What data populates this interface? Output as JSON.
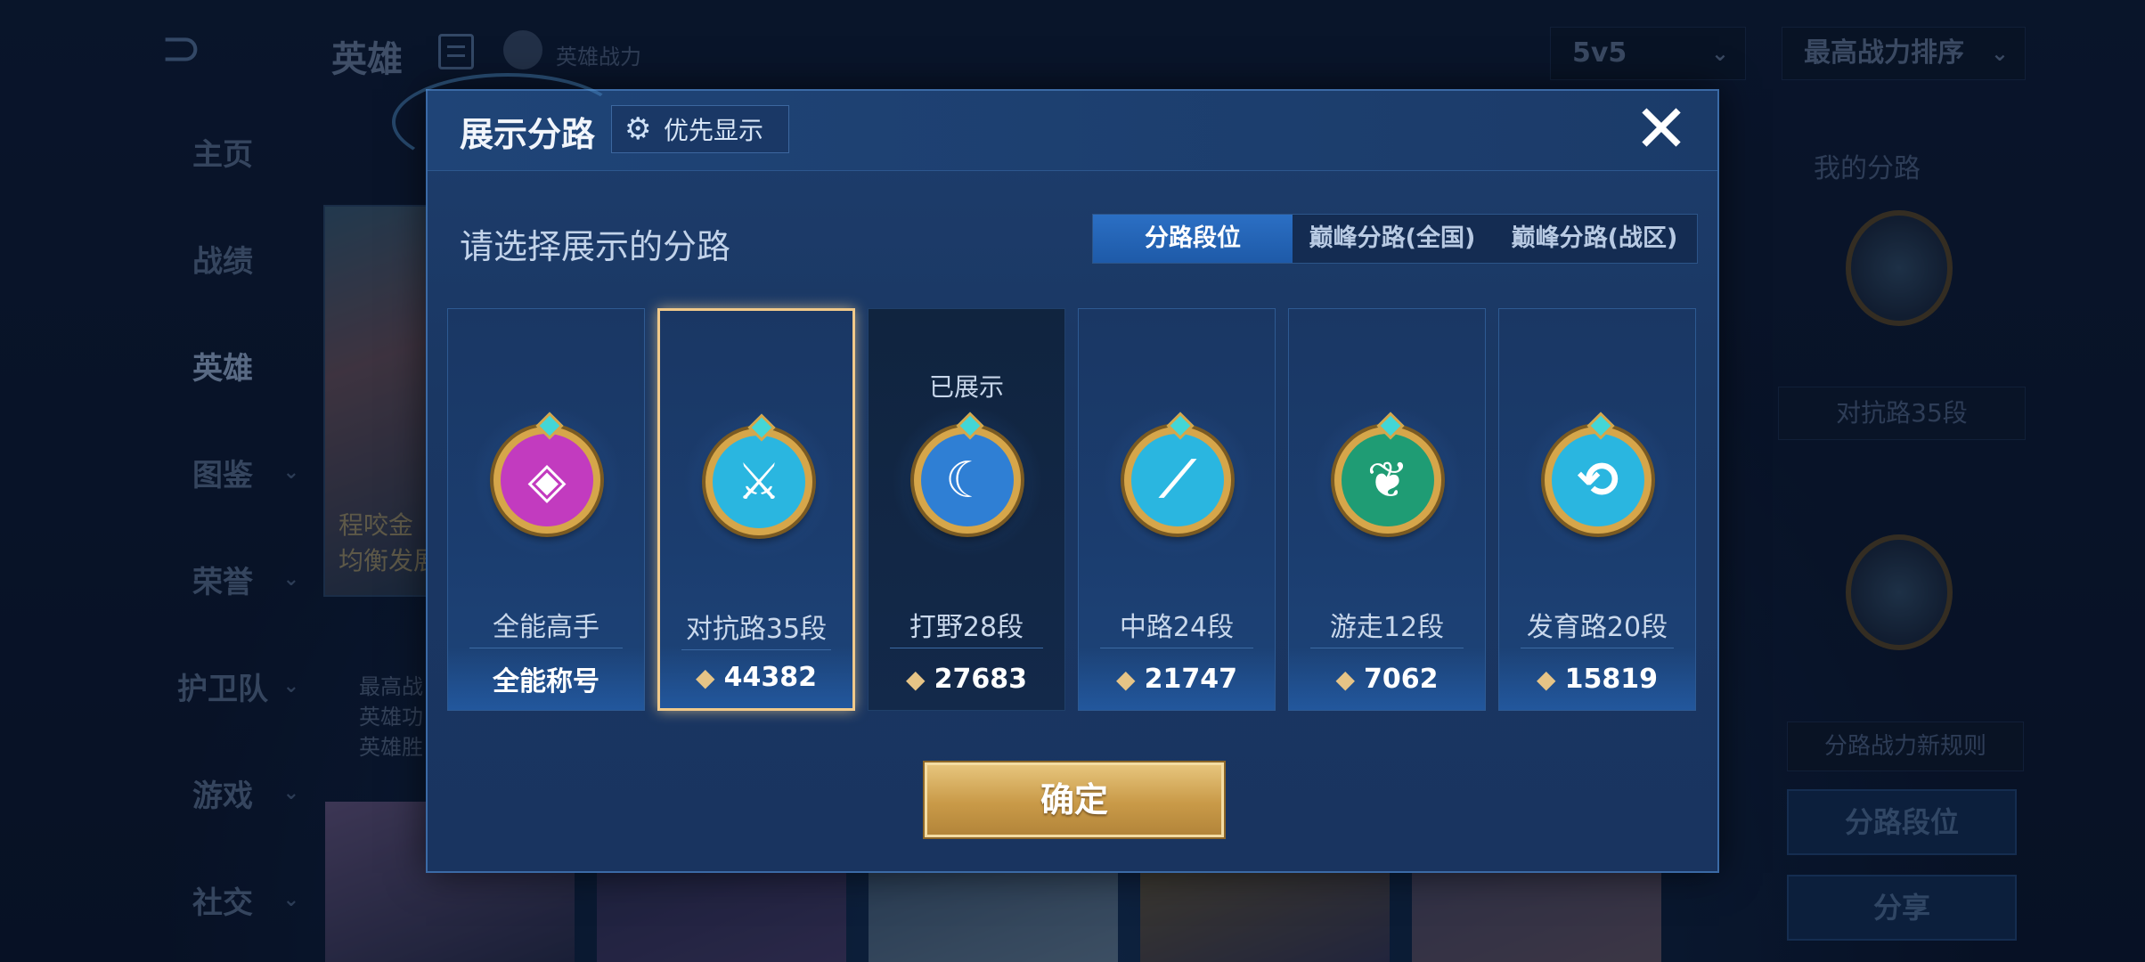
{
  "background": {
    "page_title": "英雄",
    "hero_power_label": "英雄战力",
    "mode_select": "5v5",
    "sort_select": "最高战力排序",
    "nav": [
      {
        "label": "主页"
      },
      {
        "label": "战绩"
      },
      {
        "label": "英雄"
      },
      {
        "label": "图鉴"
      },
      {
        "label": "荣誉"
      },
      {
        "label": "护卫队"
      },
      {
        "label": "游戏"
      },
      {
        "label": "社交"
      }
    ],
    "hero_card_text": [
      "程咬金",
      "均衡发展"
    ],
    "hero_info": [
      "最高战",
      "英雄功",
      "英雄胜"
    ],
    "right_panel": {
      "title": "我的分路",
      "rank": "对抗路35段",
      "rule_button": "分路战力新规则",
      "lane_rank_button": "分路段位",
      "share_button": "分享"
    }
  },
  "modal": {
    "title": "展示分路",
    "priority_label": "优先显示",
    "close_label": "✕",
    "prompt": "请选择展示的分路",
    "tabs": [
      {
        "label": "分路段位",
        "active": true
      },
      {
        "label": "巅峰分路(全国)",
        "active": false
      },
      {
        "label": "巅峰分路(战区)",
        "active": false
      }
    ],
    "shown_label": "已展示",
    "cards": [
      {
        "name": "全能高手",
        "value": "全能称号",
        "badge_icon": "all-round-icon",
        "badge_color": "#c23bbf",
        "selected": false,
        "shown": false
      },
      {
        "name": "对抗路35段",
        "value": "44382",
        "badge_icon": "clash-lane-icon",
        "badge_color": "#2ab6e0",
        "selected": true,
        "shown": false
      },
      {
        "name": "打野28段",
        "value": "27683",
        "badge_icon": "jungle-icon",
        "badge_color": "#2f7fd4",
        "selected": false,
        "shown": true
      },
      {
        "name": "中路24段",
        "value": "21747",
        "badge_icon": "mid-lane-icon",
        "badge_color": "#2ab6e0",
        "selected": false,
        "shown": false
      },
      {
        "name": "游走12段",
        "value": "7062",
        "badge_icon": "roam-icon",
        "badge_color": "#1f9c74",
        "selected": false,
        "shown": false
      },
      {
        "name": "发育路20段",
        "value": "15819",
        "badge_icon": "farm-lane-icon",
        "badge_color": "#2ab6e0",
        "selected": false,
        "shown": false
      }
    ],
    "confirm_label": "确定"
  },
  "colors": {
    "accent_gold": "#c99a48",
    "tab_active": "#2b6fc4",
    "modal_bg": "#1a3763"
  }
}
